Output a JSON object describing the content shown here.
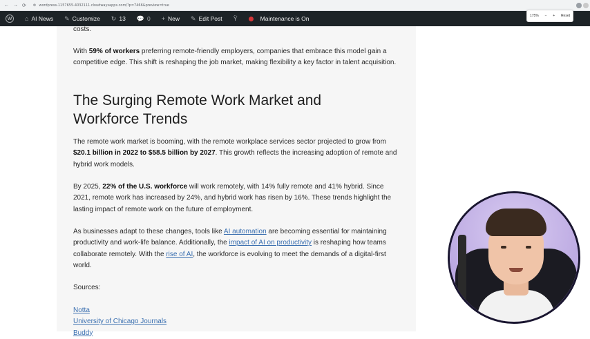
{
  "browser": {
    "url": "wordpress-1157655-4032111.cloudwaysapps.com/?p=7466&preview=true",
    "zoom": "175%",
    "zoom_minus": "−",
    "zoom_plus": "+",
    "zoom_reset": "Reset"
  },
  "admin_bar": {
    "site_name": "AI News",
    "customize": "Customize",
    "updates_count": "13",
    "comments_count": "0",
    "new_label": "New",
    "edit_post": "Edit Post",
    "maintenance": "Maintenance is On"
  },
  "article": {
    "p0": "costs.",
    "p1_prefix": "With ",
    "p1_bold": "59% of workers",
    "p1_suffix": " preferring remote-friendly employers, companies that embrace this model gain a competitive edge. This shift is reshaping the job market, making flexibility a key factor in talent acquisition.",
    "heading": "The Surging Remote Work Market and Workforce Trends",
    "p2_prefix": "The remote work market is booming, with the remote workplace services sector projected to grow from ",
    "p2_bold": "$20.1 billion in 2022 to $58.5 billion by 2027",
    "p2_suffix": ". This growth reflects the increasing adoption of remote and hybrid work models.",
    "p3_prefix": "By 2025, ",
    "p3_bold": "22% of the U.S. workforce",
    "p3_suffix": " will work remotely, with 14% fully remote and 41% hybrid. Since 2021, remote work has increased by 24%, and hybrid work has risen by 16%. These trends highlight the lasting impact of remote work on the future of employment.",
    "p4_a": "As businesses adapt to these changes, tools like ",
    "p4_link1": "AI automation",
    "p4_b": " are becoming essential for maintaining productivity and work-life balance. Additionally, the ",
    "p4_link2": "impact of AI on productivity",
    "p4_c": " is reshaping how teams collaborate remotely. With the ",
    "p4_link3": "rise of AI",
    "p4_d": ", the workforce is evolving to meet the demands of a digital-first world.",
    "sources_label": "Sources:",
    "source1": "Notta",
    "source2": "University of Chicago Journals",
    "source3": "Buddy"
  }
}
